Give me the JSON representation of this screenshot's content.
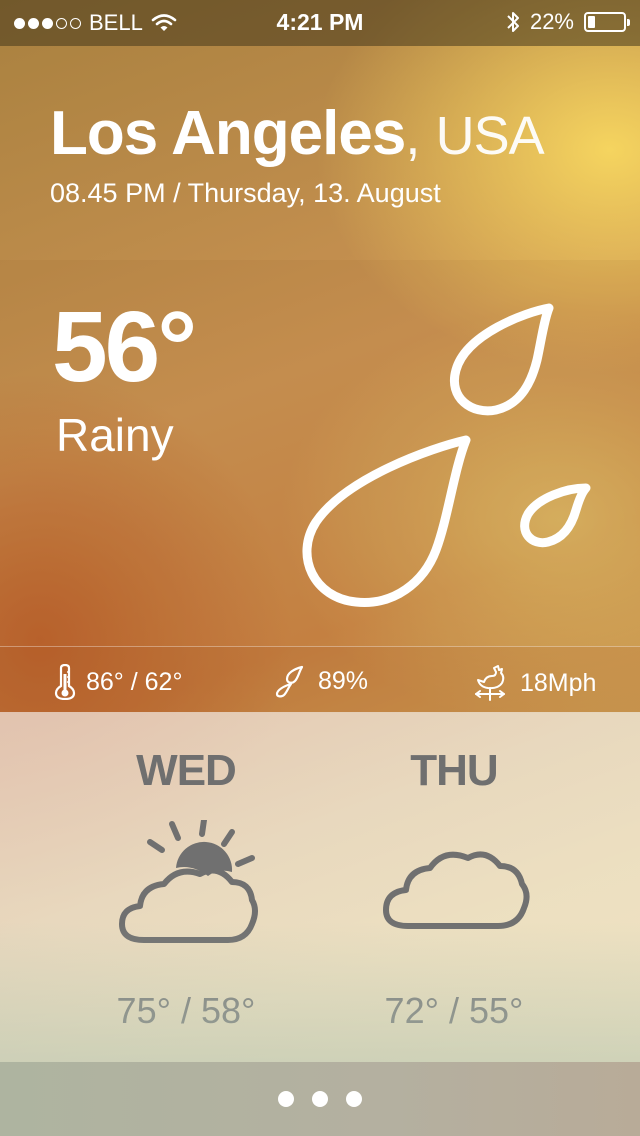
{
  "status_bar": {
    "carrier": "BELL",
    "time": "4:21 PM",
    "battery": "22%",
    "battery_level": 0.22,
    "signal_bars_filled": 3,
    "signal_bars_total": 5
  },
  "location": {
    "city": "Los Angeles",
    "separator": ",",
    "country": "USA",
    "datetime": "08.45 PM / Thursday, 13. August"
  },
  "current": {
    "temperature": "56°",
    "condition": "Rainy",
    "icon": "raindrops-icon"
  },
  "stats": {
    "temp_range": "86° / 62°",
    "humidity": "89%",
    "wind": "18Mph"
  },
  "forecast": [
    {
      "day": "WED",
      "icon": "partly-cloudy-icon",
      "range": "75° / 58°"
    },
    {
      "day": "THU",
      "icon": "cloud-icon",
      "range": "72° / 55°"
    }
  ],
  "pager": {
    "pages": 3,
    "active": 0
  },
  "colors": {
    "text_light": "#ffffff",
    "forecast_text": "#6f6f6f"
  }
}
